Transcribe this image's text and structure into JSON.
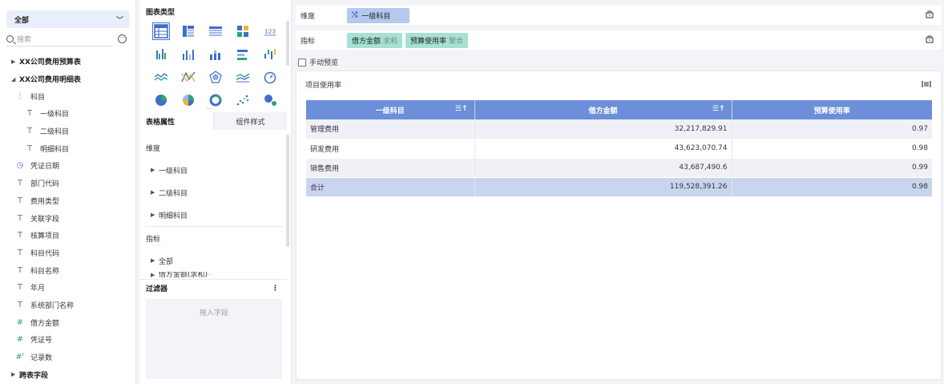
{
  "left_panel": {
    "scope_label": "全部",
    "search_placeholder": "搜索",
    "fields": [
      {
        "label": "XX公司费用预算表",
        "kind": "table",
        "expanded": false
      },
      {
        "label": "XX公司费用明细表",
        "kind": "table",
        "expanded": true
      },
      {
        "label": "科目",
        "kind": "hierarchy"
      },
      {
        "label": "一级科目",
        "kind": "text-sub"
      },
      {
        "label": "二级科目",
        "kind": "text-sub"
      },
      {
        "label": "明细科目",
        "kind": "text-sub"
      },
      {
        "label": "凭证日期",
        "kind": "date"
      },
      {
        "label": "部门代码",
        "kind": "text"
      },
      {
        "label": "费用类型",
        "kind": "text"
      },
      {
        "label": "关联字段",
        "kind": "text"
      },
      {
        "label": "核算项目",
        "kind": "text"
      },
      {
        "label": "科目代码",
        "kind": "text"
      },
      {
        "label": "科目名称",
        "kind": "text"
      },
      {
        "label": "年月",
        "kind": "text"
      },
      {
        "label": "系统部门名称",
        "kind": "text"
      },
      {
        "label": "借方金额",
        "kind": "number"
      },
      {
        "label": "凭证号",
        "kind": "number"
      },
      {
        "label": "记录数",
        "kind": "number-calc"
      },
      {
        "label": "跨表字段",
        "kind": "table",
        "expanded": false
      }
    ]
  },
  "config_panel": {
    "chart_types_title": "图表类型",
    "chart_types": [
      "table-icon",
      "cross-table-icon",
      "detail-table-icon",
      "multi-block-icon",
      "kpi-number-icon",
      "grouped-bar-icon",
      "bar-chart-icon",
      "stacked-bar-icon",
      "horizontal-bar-icon",
      "column-range-icon",
      "line-chart-icon",
      "radar-line-icon",
      "radar-icon",
      "area-chart-icon",
      "gauge-icon",
      "pie-chart-icon",
      "multi-pie-icon",
      "ring-chart-icon",
      "scatter-icon",
      "bubble-icon"
    ],
    "kpi_label": "123",
    "tabs": {
      "active": "表格属性",
      "inactive": "组件样式"
    },
    "props": {
      "dimension_label": "维度",
      "dimension_items": [
        "一级科目",
        "二级科目",
        "明细科目"
      ],
      "measure_label": "指标",
      "measure_items": [
        "全部"
      ],
      "cut_item": "借方金额(求和)"
    },
    "filter_title": "过滤器",
    "filter_more": "⋮",
    "filter_drop_hint": "拖入字段"
  },
  "shelves": {
    "dimension_label": "维度",
    "dimension_pill": "一级科目",
    "measure_label": "指标",
    "measure_pills": [
      {
        "name": "借方金额",
        "agg": "求和"
      },
      {
        "name": "预算使用率",
        "agg": "聚合"
      }
    ]
  },
  "manual_preview_label": "手动预览",
  "component": {
    "title": "项目使用率",
    "table": {
      "headers": [
        "一级科目",
        "借方金额",
        "预算使用率"
      ],
      "rows": [
        [
          "管理费用",
          "32,217,829.91",
          "0.97"
        ],
        [
          "研发费用",
          "43,623,070.74",
          "0.98"
        ],
        [
          "销售费用",
          "43,687,490.6",
          "0.99"
        ]
      ],
      "total": [
        "合计",
        "119,528,391.26",
        "0.98"
      ]
    }
  },
  "colors": {
    "header_blue": "#6d8fd9",
    "dimension_pill": "#b5c8ee",
    "measure_pill": "#a5e1d4",
    "total_row": "#c9d5ef"
  }
}
